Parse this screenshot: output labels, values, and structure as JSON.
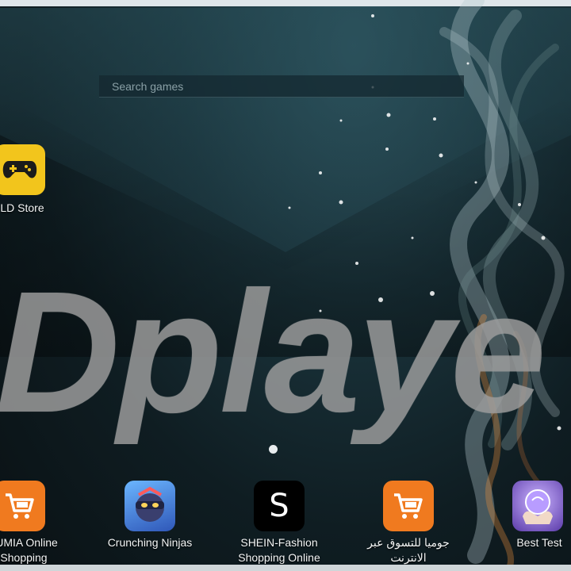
{
  "search": {
    "placeholder": "Search games"
  },
  "home_apps": [
    {
      "label": "LD Store",
      "icon": "gamepad-icon",
      "icon_bg": "#f2c51c"
    }
  ],
  "watermark": {
    "text": "Dplaye"
  },
  "pager": {
    "current_page": 1
  },
  "dock_apps": [
    {
      "label_line1": "JUMIA Online",
      "label_line2": "Shopping",
      "icon": "shopping-cart-icon",
      "icon_bg": "#f07a1f"
    },
    {
      "label_line1": "Crunching Ninjas",
      "label_line2": "",
      "icon": "ninja-game-icon",
      "icon_bg": "#3d6fd1"
    },
    {
      "label_line1": "SHEIN-Fashion",
      "label_line2": "Shopping Online",
      "icon": "letter-s-icon",
      "icon_bg": "#000000"
    },
    {
      "label_line1": "جوميا للتسوق عبر",
      "label_line2": "الانترنت",
      "icon": "shopping-cart-icon",
      "icon_bg": "#f07a1f"
    },
    {
      "label_line1": "Best Test",
      "label_line2": "",
      "icon": "crystal-ball-icon",
      "icon_bg": "#7a5bc9"
    }
  ]
}
